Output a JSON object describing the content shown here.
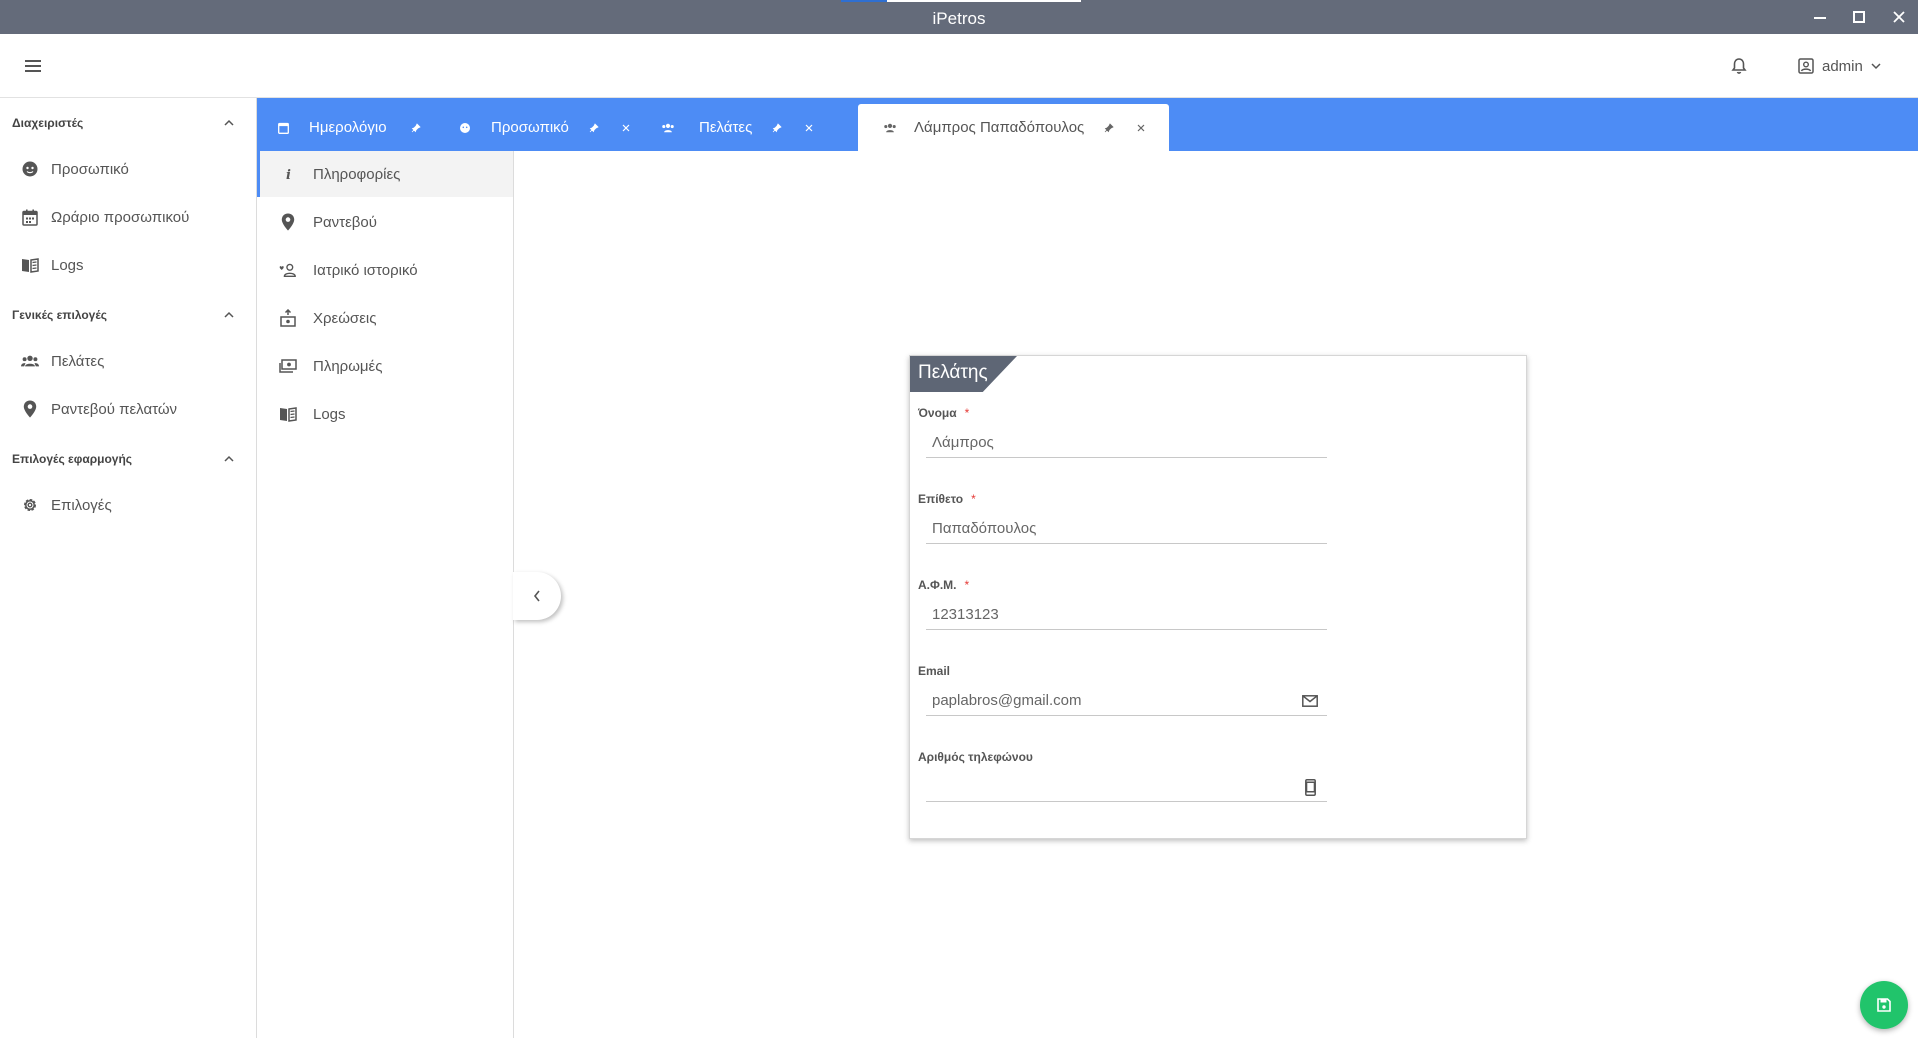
{
  "window": {
    "title": "iPetros"
  },
  "header": {
    "user_name": "admin"
  },
  "sidebar": {
    "sections": [
      {
        "title": "Διαχειριστές",
        "items": [
          {
            "label": "Προσωπικό",
            "icon": "staff-face-icon"
          },
          {
            "label": "Ωράριο προσωπικού",
            "icon": "calendar-icon"
          },
          {
            "label": "Logs",
            "icon": "book-icon"
          }
        ]
      },
      {
        "title": "Γενικές επιλογές",
        "items": [
          {
            "label": "Πελάτες",
            "icon": "people-icon"
          },
          {
            "label": "Ραντεβού πελατών",
            "icon": "location-pin-icon"
          }
        ]
      },
      {
        "title": "Επιλογές εφαρμογής",
        "items": [
          {
            "label": "Επιλογές",
            "icon": "gear-icon"
          }
        ]
      }
    ]
  },
  "tabs": [
    {
      "label": "Ημερολόγιο",
      "icon": "calendar-icon",
      "pinned": true,
      "closable": false
    },
    {
      "label": "Προσωπικό",
      "icon": "staff-face-icon",
      "pinned": true,
      "closable": true
    },
    {
      "label": "Πελάτες",
      "icon": "people-icon",
      "pinned": true,
      "closable": true
    },
    {
      "label": "Λάμπρος Παπαδόπουλος",
      "icon": "people-icon",
      "pinned": true,
      "closable": true,
      "active": true
    }
  ],
  "subnav": {
    "items": [
      {
        "label": "Πληροφορίες",
        "icon": "info-icon",
        "active": true
      },
      {
        "label": "Ραντεβού",
        "icon": "location-pin-icon"
      },
      {
        "label": "Ιατρικό ιστορικό",
        "icon": "medical-history-icon"
      },
      {
        "label": "Χρεώσεις",
        "icon": "charges-icon"
      },
      {
        "label": "Πληρωμές",
        "icon": "payments-icon"
      },
      {
        "label": "Logs",
        "icon": "book-icon"
      }
    ]
  },
  "form": {
    "title": "Πελάτης",
    "fields": {
      "first_name": {
        "label": "Όνομα",
        "required": true,
        "value": "Λάμπρος"
      },
      "last_name": {
        "label": "Επίθετο",
        "required": true,
        "value": "Παπαδόπουλος"
      },
      "afm": {
        "label": "Α.Φ.Μ.",
        "required": true,
        "value": "12313123"
      },
      "email": {
        "label": "Email",
        "required": false,
        "value": "paplabros@gmail.com"
      },
      "phone": {
        "label": "Αριθμός τηλεφώνου",
        "required": false,
        "value": ""
      }
    },
    "required_mark": "*"
  },
  "colors": {
    "titlebar": "#646b7a",
    "tabbar": "#4d8cf5",
    "save_button": "#21c46b",
    "required": "#e53935"
  }
}
